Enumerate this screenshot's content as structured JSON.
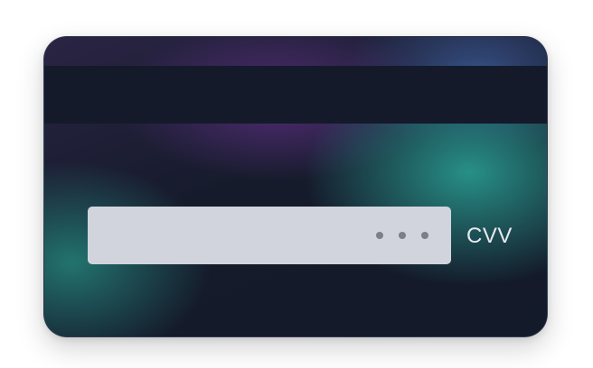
{
  "card_back": {
    "cvv_label": "CVV",
    "cvv_masked_digit_count": 3
  },
  "colors": {
    "stripe": "#141a2a",
    "signature_panel": "#d1d4dc",
    "mask_dot": "#7b7f88",
    "accent_teal": "#2a968c",
    "accent_purple": "#552d78"
  }
}
